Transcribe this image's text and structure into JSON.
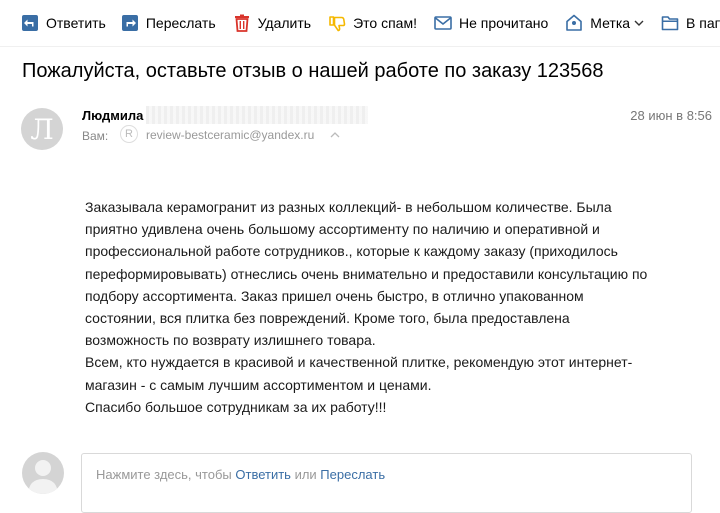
{
  "toolbar": {
    "reply_label": "Ответить",
    "forward_label": "Переслать",
    "delete_label": "Удалить",
    "spam_label": "Это спам!",
    "unread_label": "Не прочитано",
    "label_label": "Метка",
    "folder_label": "В папку"
  },
  "message": {
    "subject": "Пожалуйста, оставьте отзыв о нашей работе по заказу 123568",
    "sender_name": "Людмила",
    "sender_avatar_letter": "Л",
    "date": "28 июн в 8:56",
    "to_label": "Вам:",
    "to_badge_letter": "R",
    "to_address": "review-bestceramic@yandex.ru",
    "body_lines": [
      "Заказывала керамогранит из разных коллекций- в небольшом количестве. Была",
      "приятно удивлена очень большому ассортименту по наличию и оперативной и",
      "профессиональной работе сотрудников., которые к каждому заказу (приходилось",
      "переформировывать) отнеслись очень внимательно и предоставили консультацию по",
      "подбору ассортимента. Заказ пришел очень быстро, в отлично упакованном",
      "состоянии, вся плитка без повреждений. Кроме того, была предоставлена",
      "возможность по возврату излишнего товара.",
      "Всем, кто нуждается в красивой и качественной плитке, рекомендую этот интернет-",
      "магазин - с самым лучшим ассортиментом и ценами.",
      "Спасибо большое сотрудникам за их работу!!!"
    ]
  },
  "reply": {
    "prefix": "Нажмите здесь, чтобы ",
    "reply_link": "Ответить",
    "middle": " или ",
    "forward_link": "Переслать"
  },
  "colors": {
    "accent_blue": "#3a6ea5",
    "delete_red": "#d9342b",
    "spam_yellow": "#f5b800"
  }
}
